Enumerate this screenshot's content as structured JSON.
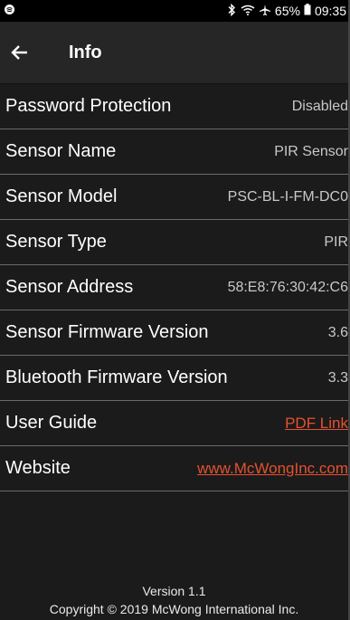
{
  "status": {
    "battery": "65%",
    "time": "09:35"
  },
  "header": {
    "title": "Info"
  },
  "rows": [
    {
      "label": "Password Protection",
      "value": "Disabled"
    },
    {
      "label": "Sensor Name",
      "value": "PIR Sensor"
    },
    {
      "label": "Sensor Model",
      "value": "PSC-BL-I-FM-DC0"
    },
    {
      "label": "Sensor Type",
      "value": "PIR"
    },
    {
      "label": "Sensor Address",
      "value": "58:E8:76:30:42:C6"
    },
    {
      "label": "Sensor Firmware Version",
      "value": "3.6"
    },
    {
      "label": "Bluetooth Firmware Version",
      "value": "3.3"
    },
    {
      "label": "User Guide",
      "value": "PDF Link"
    },
    {
      "label": "Website",
      "value": "www.McWongInc.com"
    }
  ],
  "footer": {
    "version": "Version 1.1",
    "copyright": "Copyright © 2019 McWong International Inc."
  },
  "colors": {
    "link": "#e4512f",
    "background": "#1b1b1b",
    "appbar": "#262626"
  }
}
